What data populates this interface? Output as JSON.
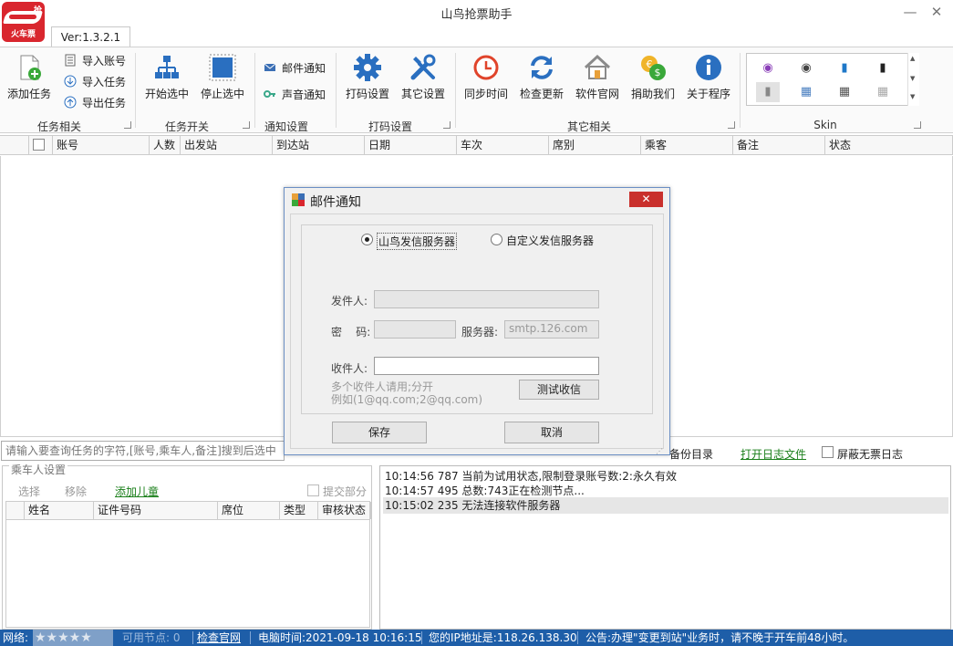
{
  "window": {
    "title": "山鸟抢票助手",
    "minimize": "—",
    "close": "✕"
  },
  "logo": {
    "line1": "抢",
    "line2": "火车票"
  },
  "version": "Ver:1.3.2.1",
  "ribbon": {
    "groups": {
      "task": "任务相关",
      "switch": "任务开关",
      "notify": "通知设置",
      "captcha": "打码设置",
      "other": "其它相关",
      "skin": "Skin"
    },
    "add_task": "添加任务",
    "import_account": "导入账号",
    "import_task": "导入任务",
    "export_task": "导出任务",
    "start_selected": "开始选中",
    "stop_selected": "停止选中",
    "mail_notify": "邮件通知",
    "sound_notify": "声音通知",
    "captcha_settings": "打码设置",
    "other_settings": "其它设置",
    "sync_time": "同步时间",
    "check_update": "检查更新",
    "website": "软件官网",
    "donate": "捐助我们",
    "about": "关于程序"
  },
  "task_table": {
    "columns": [
      "账号",
      "人数",
      "出发站",
      "到达站",
      "日期",
      "车次",
      "席别",
      "乘客",
      "备注",
      "状态"
    ]
  },
  "search": {
    "placeholder": "请输入要查询任务的字符,[账号,乘车人,备注]搜到后选中"
  },
  "log_links": {
    "backup_dir": "备份目录",
    "open_log": "打开日志文件",
    "hide_no_ticket": "屏蔽无票日志"
  },
  "passenger": {
    "legend": "乘车人设置",
    "select": "选择",
    "remove": "移除",
    "add_child": "添加儿童",
    "submit_part": "提交部分",
    "columns": [
      "姓名",
      "证件号码",
      "席位",
      "类型",
      "审核状态"
    ]
  },
  "log": [
    "10:14:56 787 当前为试用状态,限制登录账号数:2:永久有效",
    "10:14:57 495 总数:743正在检测节点...",
    "10:15:02 235 无法连接软件服务器"
  ],
  "status": {
    "network": "网络:",
    "nodes": "可用节点: 0",
    "check_site": "检查官网",
    "pc_time": "电脑时间:2021-09-18 10:16:15",
    "ip": "您的IP地址是:118.26.138.30",
    "notice": "公告:办理\"变更到站\"业务时，请不晚于开车前48小时。",
    "stars": "★★★★★"
  },
  "modal": {
    "title": "邮件通知",
    "close": "✕",
    "radio_builtin": "山鸟发信服务器",
    "radio_custom": "自定义发信服务器",
    "sender_label": "发件人:",
    "password_label": "密    码:",
    "server_label": "服务器:",
    "server_value": "smtp.126.com",
    "receiver_label": "收件人:",
    "hint_line1": "多个收件人请用;分开",
    "hint_line2": "例如(1@qq.com;2@qq.com)",
    "test_button": "测试收信",
    "save_button": "保存",
    "cancel_button": "取消"
  },
  "colors": {
    "accent_blue": "#1e5ea8",
    "link_green": "#1a7f1a",
    "close_red": "#c9302c"
  }
}
